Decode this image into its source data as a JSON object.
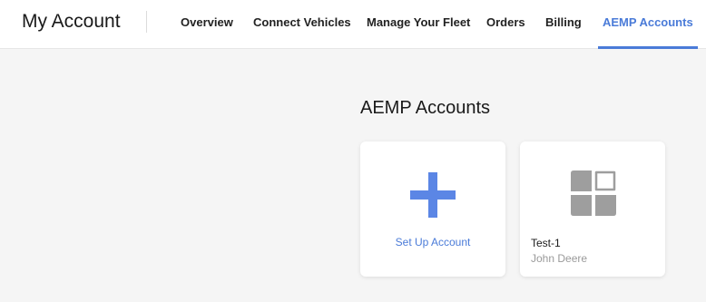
{
  "header": {
    "title": "My Account",
    "tabs": [
      {
        "label": "Overview",
        "active": false
      },
      {
        "label": "Connect Vehicles",
        "active": false
      },
      {
        "label": "Manage Your Fleet",
        "active": false
      },
      {
        "label": "Orders",
        "active": false
      },
      {
        "label": "Billing",
        "active": false
      },
      {
        "label": "AEMP Accounts",
        "active": true
      }
    ]
  },
  "main": {
    "title": "AEMP Accounts",
    "setup_card": {
      "icon": "plus-icon",
      "label": "Set Up Account"
    },
    "accounts": [
      {
        "icon": "tiles-icon",
        "name": "Test-1",
        "provider": "John Deere"
      }
    ]
  },
  "colors": {
    "accent": "#4a7bd8",
    "plus_icon": "#5b86e5",
    "tiles_icon": "#9e9e9e",
    "background": "#f5f5f5"
  }
}
